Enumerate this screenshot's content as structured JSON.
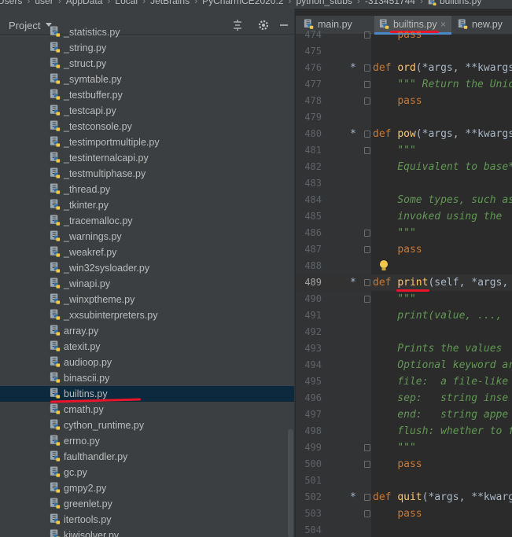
{
  "breadcrumb": {
    "items": [
      "Users",
      "user",
      "AppData",
      "Local",
      "JetBrains",
      "PyCharmCE2020.2",
      "python_stubs",
      "-313451744",
      "builtins.py"
    ]
  },
  "project_panel": {
    "title": "Project",
    "icons": [
      "sort-icon",
      "gear-icon",
      "minimize-icon"
    ],
    "files": [
      {
        "name": "_statistics.py",
        "selected": false
      },
      {
        "name": "_string.py",
        "selected": false
      },
      {
        "name": "_struct.py",
        "selected": false
      },
      {
        "name": "_symtable.py",
        "selected": false
      },
      {
        "name": "_testbuffer.py",
        "selected": false
      },
      {
        "name": "_testcapi.py",
        "selected": false
      },
      {
        "name": "_testconsole.py",
        "selected": false
      },
      {
        "name": "_testimportmultiple.py",
        "selected": false
      },
      {
        "name": "_testinternalcapi.py",
        "selected": false
      },
      {
        "name": "_testmultiphase.py",
        "selected": false
      },
      {
        "name": "_thread.py",
        "selected": false
      },
      {
        "name": "_tkinter.py",
        "selected": false
      },
      {
        "name": "_tracemalloc.py",
        "selected": false
      },
      {
        "name": "_warnings.py",
        "selected": false
      },
      {
        "name": "_weakref.py",
        "selected": false
      },
      {
        "name": "_win32sysloader.py",
        "selected": false
      },
      {
        "name": "_winapi.py",
        "selected": false
      },
      {
        "name": "_winxptheme.py",
        "selected": false
      },
      {
        "name": "_xxsubinterpreters.py",
        "selected": false
      },
      {
        "name": "array.py",
        "selected": false
      },
      {
        "name": "atexit.py",
        "selected": false
      },
      {
        "name": "audioop.py",
        "selected": false
      },
      {
        "name": "binascii.py",
        "selected": false
      },
      {
        "name": "builtins.py",
        "selected": true
      },
      {
        "name": "cmath.py",
        "selected": false
      },
      {
        "name": "cython_runtime.py",
        "selected": false
      },
      {
        "name": "errno.py",
        "selected": false
      },
      {
        "name": "faulthandler.py",
        "selected": false
      },
      {
        "name": "gc.py",
        "selected": false
      },
      {
        "name": "gmpy2.py",
        "selected": false
      },
      {
        "name": "greenlet.py",
        "selected": false
      },
      {
        "name": "itertools.py",
        "selected": false
      },
      {
        "name": "kiwisolver.py",
        "selected": false
      }
    ]
  },
  "editor": {
    "tabs": [
      {
        "label": "main.py",
        "active": false
      },
      {
        "label": "builtins.py",
        "active": true
      },
      {
        "label": "new.py",
        "active": false
      }
    ],
    "current_line": 489,
    "lines": [
      {
        "n": 474,
        "text": "    pass"
      },
      {
        "n": 475,
        "text": ""
      },
      {
        "n": 476,
        "text": "def ord(*args, **kwargs)"
      },
      {
        "n": 477,
        "text": "    \"\"\" Return the Unicode"
      },
      {
        "n": 478,
        "text": "    pass"
      },
      {
        "n": 479,
        "text": ""
      },
      {
        "n": 480,
        "text": "def pow(*args, **kwargs)"
      },
      {
        "n": 481,
        "text": "    \"\"\""
      },
      {
        "n": 482,
        "text": "    Equivalent to base**"
      },
      {
        "n": 483,
        "text": ""
      },
      {
        "n": 484,
        "text": "    Some types, such as"
      },
      {
        "n": 485,
        "text": "    invoked using the"
      },
      {
        "n": 486,
        "text": "    \"\"\""
      },
      {
        "n": 487,
        "text": "    pass"
      },
      {
        "n": 488,
        "text": ""
      },
      {
        "n": 489,
        "text": "def print(self, *args,"
      },
      {
        "n": 490,
        "text": "    \"\"\""
      },
      {
        "n": 491,
        "text": "    print(value, ...,"
      },
      {
        "n": 492,
        "text": ""
      },
      {
        "n": 493,
        "text": "    Prints the values"
      },
      {
        "n": 494,
        "text": "    Optional keyword ar"
      },
      {
        "n": 495,
        "text": "    file:  a file-like"
      },
      {
        "n": 496,
        "text": "    sep:   string inse"
      },
      {
        "n": 497,
        "text": "    end:   string appe"
      },
      {
        "n": 498,
        "text": "    flush: whether to f"
      },
      {
        "n": 499,
        "text": "    \"\"\""
      },
      {
        "n": 500,
        "text": "    pass"
      },
      {
        "n": 501,
        "text": ""
      },
      {
        "n": 502,
        "text": "def quit(*args, **kwarg"
      },
      {
        "n": 503,
        "text": "    pass"
      },
      {
        "n": 504,
        "text": ""
      }
    ]
  },
  "colors": {
    "keyword": "#cc7832",
    "function": "#ffc66d",
    "docstring": "#629755",
    "selection": "#0d293e",
    "annotation": "#e8162a"
  }
}
